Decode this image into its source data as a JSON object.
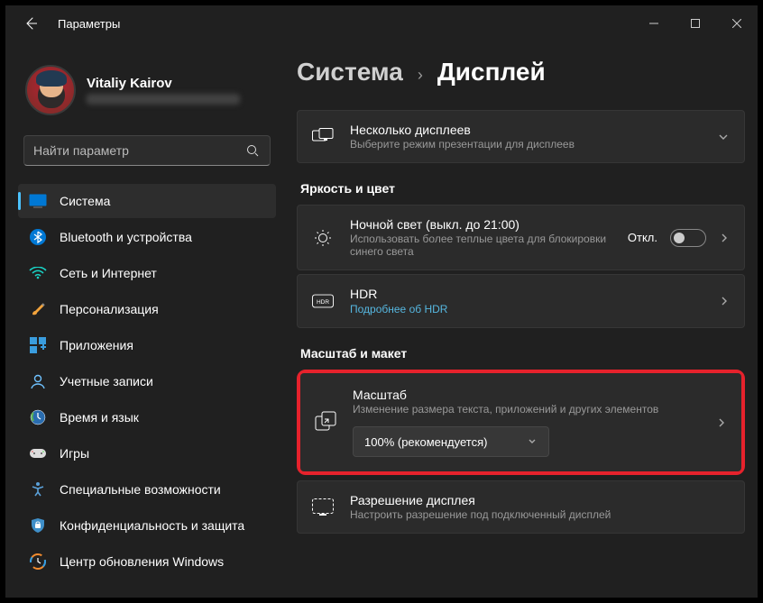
{
  "titlebar": {
    "title": "Параметры"
  },
  "profile": {
    "name": "Vitaliy Kairov"
  },
  "search": {
    "placeholder": "Найти параметр"
  },
  "sidebar": {
    "items": [
      {
        "label": "Система"
      },
      {
        "label": "Bluetooth и устройства"
      },
      {
        "label": "Сеть и Интернет"
      },
      {
        "label": "Персонализация"
      },
      {
        "label": "Приложения"
      },
      {
        "label": "Учетные записи"
      },
      {
        "label": "Время и язык"
      },
      {
        "label": "Игры"
      },
      {
        "label": "Специальные возможности"
      },
      {
        "label": "Конфиденциальность и защита"
      },
      {
        "label": "Центр обновления Windows"
      }
    ]
  },
  "breadcrumb": {
    "main": "Система",
    "sub": "Дисплей"
  },
  "cards": {
    "multi": {
      "title": "Несколько дисплеев",
      "desc": "Выберите режим презентации для дисплеев"
    },
    "brightness_section": "Яркость и цвет",
    "night": {
      "title": "Ночной свет (выкл. до 21:00)",
      "desc": "Использовать более теплые цвета для блокировки синего света",
      "status": "Откл."
    },
    "hdr": {
      "title": "HDR",
      "link": "Подробнее об HDR"
    },
    "scale_section": "Масштаб и макет",
    "scale": {
      "title": "Масштаб",
      "desc": "Изменение размера текста, приложений и других элементов",
      "value": "100% (рекомендуется)"
    },
    "res": {
      "title": "Разрешение дисплея",
      "desc": "Настроить разрешение под подключенный дисплей"
    }
  }
}
